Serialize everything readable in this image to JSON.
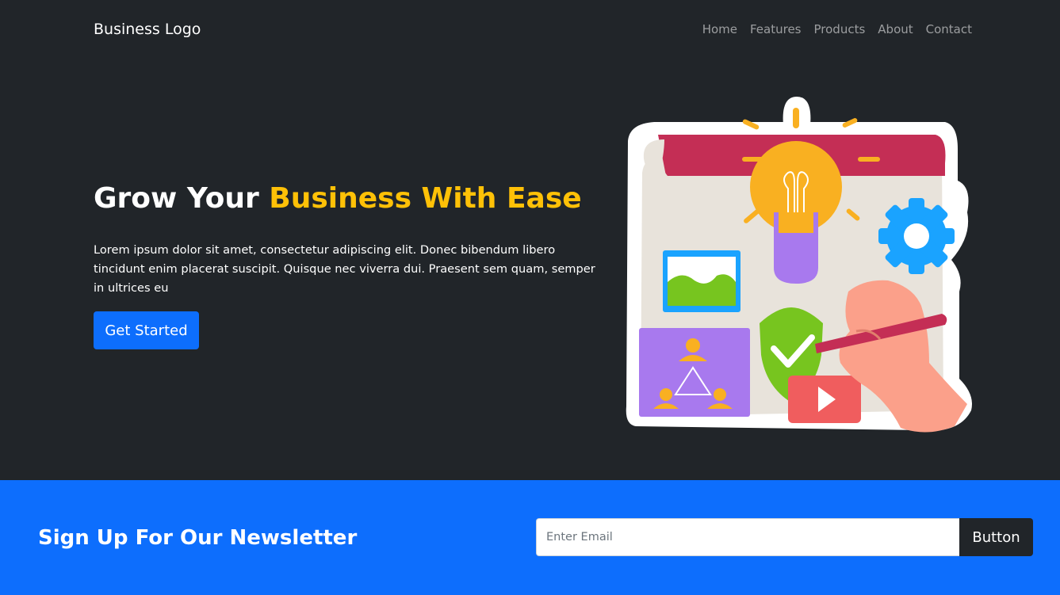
{
  "navbar": {
    "brand": "Business Logo",
    "links": [
      "Home",
      "Features",
      "Products",
      "About",
      "Contact"
    ]
  },
  "hero": {
    "title_plain": "Grow Your",
    "title_accent": "Business With Ease",
    "description": "Lorem ipsum dolor sit amet, consectetur adipiscing elit. Donec bibendum libero tincidunt enim placerat suscipit. Quisque nec viverra dui. Praesent sem quam, semper in ultrices eu",
    "cta_label": "Get Started",
    "illustration_icon": "business-ideas-illustration"
  },
  "newsletter": {
    "heading": "Sign Up For Our Newsletter",
    "email_placeholder": "Enter Email",
    "button_label": "Button"
  },
  "colors": {
    "dark": "#212529",
    "accent_yellow": "#ffc107",
    "primary_blue": "#0d6efd",
    "nav_link": "rgba(255,255,255,0.55)"
  }
}
